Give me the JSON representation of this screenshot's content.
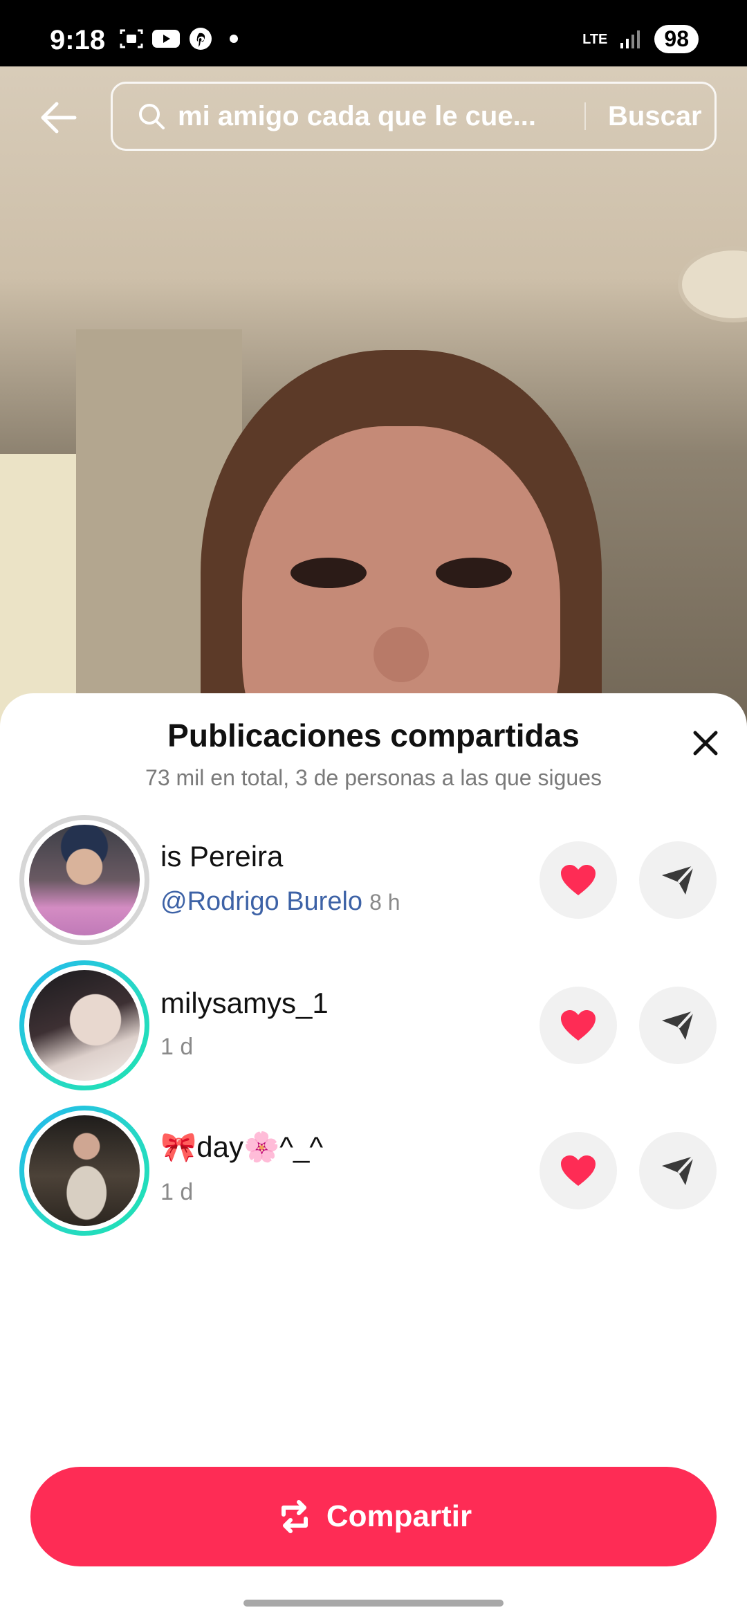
{
  "status_bar": {
    "time": "9:18",
    "network": "LTE",
    "battery": "98",
    "icons": [
      "screenshot-icon",
      "youtube-icon",
      "pinterest-icon",
      "notification-dot",
      "signal-icon"
    ]
  },
  "search": {
    "query": "mi amigo cada que le cue...",
    "button_label": "Buscar"
  },
  "sheet": {
    "title": "Publicaciones compartidas",
    "subtitle": "73 mil en total, 3 de personas a las que sigues"
  },
  "rows": [
    {
      "name": "is Pereira",
      "mention": "@Rodrigo Burelo",
      "time": "8 h"
    },
    {
      "name": "milysamys_1",
      "time": "1 d"
    },
    {
      "name": "🎀day🌸^_^",
      "time": "1 d"
    }
  ],
  "share_button": {
    "label": "Compartir"
  },
  "colors": {
    "accent": "#fe2c55",
    "mention": "#3d62a6",
    "heart": "#fe2c55",
    "story_ring": "#22b7f0"
  }
}
